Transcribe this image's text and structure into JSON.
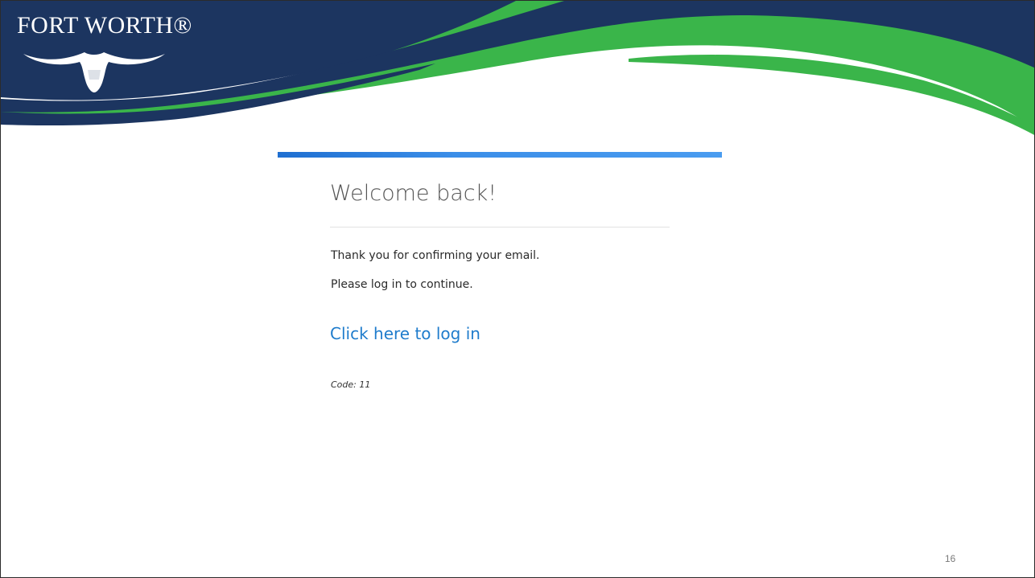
{
  "header": {
    "logo_text": "FORT WORTH®",
    "logo_icon": "longhorn-icon",
    "colors": {
      "navy": "#1c3560",
      "green": "#3ab54a",
      "white": "#ffffff"
    }
  },
  "card": {
    "accent_color": "#3b8ee8",
    "title": "Welcome back!",
    "message_line_1": "Thank you for confirming your email.",
    "message_line_2": "Please log in to continue.",
    "login_link": "Click here to log in",
    "code": "Code: 11",
    "link_color": "#1f7ccc"
  },
  "footer": {
    "page_number": "16"
  }
}
